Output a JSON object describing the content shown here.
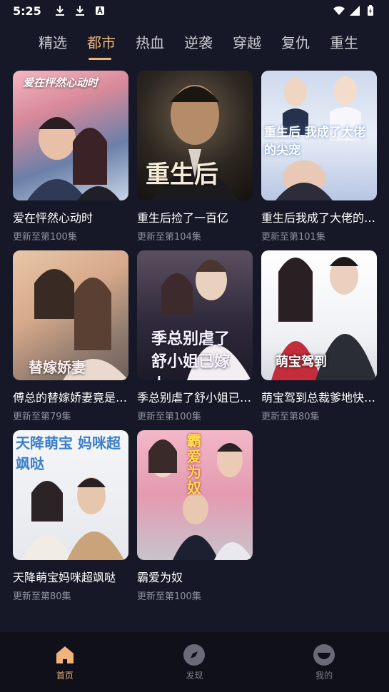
{
  "status": {
    "time": "5:25"
  },
  "tabs": [
    {
      "label": "精选",
      "active": false
    },
    {
      "label": "都市",
      "active": true
    },
    {
      "label": "热血",
      "active": false
    },
    {
      "label": "逆袭",
      "active": false
    },
    {
      "label": "穿越",
      "active": false
    },
    {
      "label": "复仇",
      "active": false
    },
    {
      "label": "重生",
      "active": false
    }
  ],
  "dramas": [
    {
      "title": "爱在怦然心动时",
      "subtitle": "更新至第100集",
      "poster_text": "爱在怦然心动时"
    },
    {
      "title": "重生后捡了一百亿",
      "subtitle": "更新至第104集",
      "poster_text": "重生后"
    },
    {
      "title": "重生后我成了大佬的尖宠",
      "subtitle": "更新至第101集",
      "poster_text": "重生后 我成了大佬的尖宠"
    },
    {
      "title": "傅总的替嫁娇妻竟是大佬",
      "subtitle": "更新至第79集",
      "poster_text": "替嫁娇妻"
    },
    {
      "title": "季总别虐了舒小姐已嫁人",
      "subtitle": "更新至第100集",
      "poster_text": "季总别虐了 舒小姐已嫁人"
    },
    {
      "title": "萌宝驾到总裁爹地快快来",
      "subtitle": "更新至第80集",
      "poster_text": "萌宝驾到"
    },
    {
      "title": "天降萌宝妈咪超飒哒",
      "subtitle": "更新至第80集",
      "poster_text": "天降萌宝 妈咪超飒哒"
    },
    {
      "title": "霸爱为奴",
      "subtitle": "更新至第100集",
      "poster_text": "霸爱为奴"
    }
  ],
  "nav": [
    {
      "label": "首页",
      "icon": "home-icon",
      "active": true
    },
    {
      "label": "发现",
      "icon": "compass-icon",
      "active": false
    },
    {
      "label": "我的",
      "icon": "profile-icon",
      "active": false
    }
  ],
  "colors": {
    "accent": "#f0b47a",
    "background": "#161827",
    "nav_background": "#0f101a"
  }
}
